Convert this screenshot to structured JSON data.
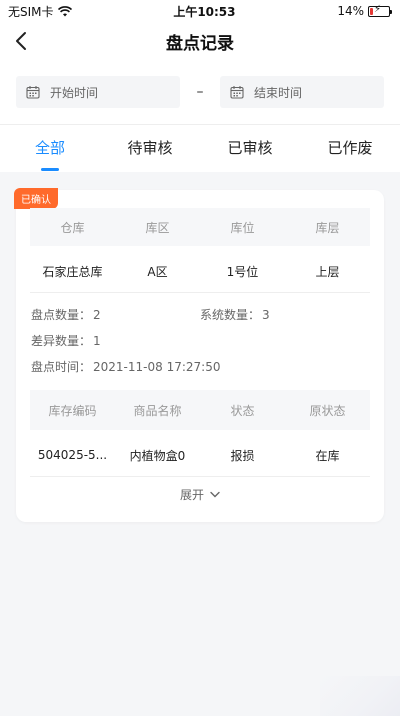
{
  "status_bar": {
    "carrier": "无SIM卡",
    "time": "上午10:53",
    "battery_text": "14%",
    "battery_level": 0.14,
    "icons": [
      "wifi-icon",
      "battery-icon",
      "charging-icon"
    ]
  },
  "nav": {
    "title": "盘点记录",
    "back_icon": "chevron-left-icon"
  },
  "filters": {
    "start_placeholder": "开始时间",
    "end_placeholder": "结束时间",
    "separator": "–",
    "icon": "calendar-icon"
  },
  "tabs": [
    {
      "label": "全部",
      "active": true
    },
    {
      "label": "待审核",
      "active": false
    },
    {
      "label": "已审核",
      "active": false
    },
    {
      "label": "已作废",
      "active": false
    }
  ],
  "record": {
    "badge": "已确认",
    "location_headers": [
      "仓库",
      "库区",
      "库位",
      "库层"
    ],
    "location_values": [
      "石家庄总库",
      "A区",
      "1号位",
      "上层"
    ],
    "count_label": "盘点数量：",
    "count_value": "2",
    "system_label": "系统数量：",
    "system_value": "3",
    "diff_label": "差异数量：",
    "diff_value": "1",
    "time_label": "盘点时间：",
    "time_value": "2021-11-08 17:27:50",
    "goods_headers": [
      "库存编码",
      "商品名称",
      "状态",
      "原状态"
    ],
    "goods_row": [
      "504025-5...",
      "内植物盒0",
      "报损",
      "在库"
    ],
    "expand_label": "展开",
    "expand_icon": "chevron-down-icon"
  },
  "colors": {
    "accent": "#1a8cff",
    "badge": "#ff6a2b",
    "background": "#f5f6f8"
  }
}
